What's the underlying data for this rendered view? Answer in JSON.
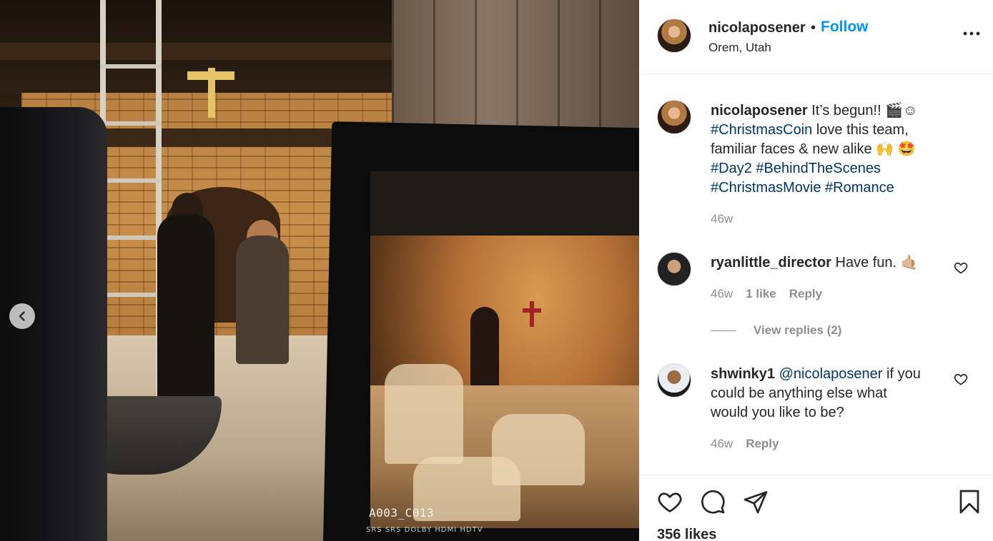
{
  "post": {
    "media": {
      "slate_code": "A003_C013",
      "bezel_labels": "SRS  SRS  DOLBY  HDMI  HDTV",
      "prev_icon": "chevron-left-icon"
    },
    "header": {
      "username": "nicolaposener",
      "separator": "•",
      "follow_label": "Follow",
      "location": "Orem, Utah",
      "more_icon": "more-horizontal-icon"
    },
    "caption": {
      "username": "nicolaposener",
      "text_1": " It’s begun!! 🎬☺",
      "tag_1": "#ChristmasCoin",
      "text_2": " love this team,",
      "text_3": "familiar faces & new alike 🙌 🤩",
      "tag_2": "#Day2",
      "tag_3": "#BehindTheScenes",
      "tag_4": "#ChristmasMovie",
      "tag_5": "#Romance",
      "time": "46w"
    },
    "comments": [
      {
        "username": "ryanlittle_director",
        "text": " Have fun. 🤙🏼",
        "time": "46w",
        "likes": "1 like",
        "reply_label": "Reply",
        "view_replies": "View replies (2)"
      },
      {
        "username": "shwinky1",
        "mention": "@nicolaposener",
        "text_1": " if you",
        "text_2": "could be anything else what",
        "text_3": "would you like to be?",
        "time": "46w",
        "reply_label": "Reply"
      }
    ],
    "actions": {
      "like_icon": "heart-icon",
      "comment_icon": "comment-icon",
      "share_icon": "send-icon",
      "save_icon": "bookmark-icon",
      "likes_count": "356 likes"
    }
  },
  "colors": {
    "link_blue": "#0095f6",
    "hashtag_blue": "#00376b",
    "text_primary": "#262626",
    "text_secondary": "#8e8e8e",
    "divider": "#efefef"
  }
}
